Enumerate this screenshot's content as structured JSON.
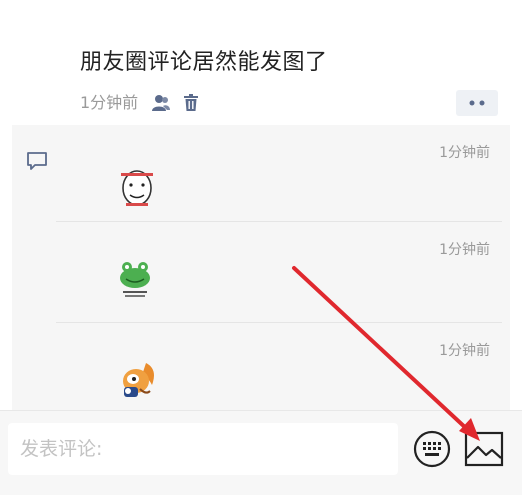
{
  "post": {
    "text": "朋友圈评论居然能发图了",
    "time": "1分钟前"
  },
  "comments": [
    {
      "time": "1分钟前",
      "sticker": "smiling-face-sticker"
    },
    {
      "time": "1分钟前",
      "sticker": "green-frog-sticker"
    },
    {
      "time": "1分钟前",
      "sticker": "cartoon-squirrel-sticker"
    }
  ],
  "input_bar": {
    "placeholder": "发表评论:",
    "value": "",
    "buttons": [
      "keyboard-icon",
      "image-icon"
    ]
  },
  "colors": {
    "background": "#ffffff",
    "panel": "#f6f6f6",
    "meta_text": "#9a9a9a",
    "accent_blue": "#5b6b8c",
    "annotation_arrow": "#e0282e"
  }
}
